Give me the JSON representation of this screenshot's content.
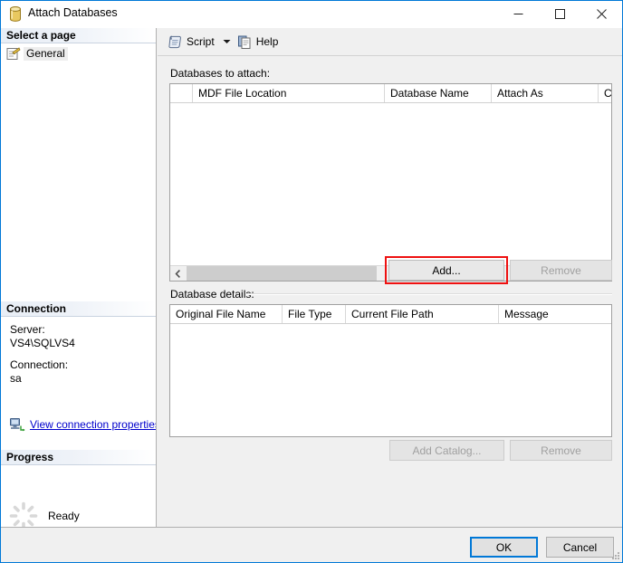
{
  "window": {
    "title": "Attach Databases",
    "icon": "database-cylinder-icon",
    "minimize_label": "Minimize",
    "maximize_label": "Maximize",
    "close_label": "Close"
  },
  "sidebar": {
    "select_page_heading": "Select a page",
    "pages": [
      {
        "label": "General",
        "icon": "page-general-icon",
        "selected": true
      }
    ],
    "connection_heading": "Connection",
    "server_label": "Server:",
    "server_value": "VS4\\SQLVS4",
    "connection_label": "Connection:",
    "connection_value": "sa",
    "view_properties_link": "View connection properties",
    "view_properties_icon": "connection-properties-icon",
    "progress_heading": "Progress",
    "progress_icon": "spinner-ring-icon",
    "progress_text": "Ready"
  },
  "toolbar": {
    "script_label": "Script",
    "script_icon": "script-scroll-icon",
    "script_caret_icon": "chevron-down-icon",
    "help_label": "Help",
    "help_icon": "help-documents-icon"
  },
  "main": {
    "databases_to_attach_label": "Databases to attach:",
    "attach_grid": {
      "columns": [
        "",
        "MDF File Location",
        "Database Name",
        "Attach As",
        "C"
      ],
      "rows": [],
      "scroll": {
        "thumb_left_pct": 4,
        "thumb_width_pct": 44
      }
    },
    "add_button": "Add...",
    "add_button_highlight_color": "#ee1111",
    "remove_button": "Remove",
    "remove_button_disabled": true,
    "database_details_label": "Database details:",
    "details_grid": {
      "columns": [
        "Original File Name",
        "File Type",
        "Current File Path",
        "Message"
      ],
      "rows": []
    },
    "add_catalog_button": "Add Catalog...",
    "add_catalog_disabled": true,
    "details_remove_button": "Remove",
    "details_remove_disabled": true
  },
  "footer": {
    "ok_label": "OK",
    "cancel_label": "Cancel"
  },
  "colors": {
    "accent": "#0078d7",
    "highlight": "#ee1111",
    "link": "#0000cc"
  }
}
